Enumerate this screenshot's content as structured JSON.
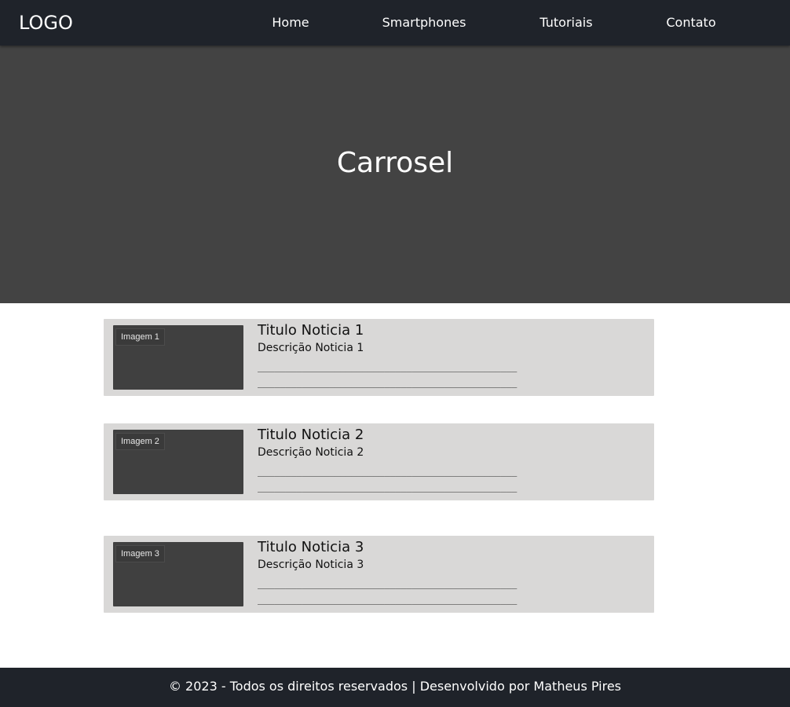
{
  "header": {
    "logo": "LOGO",
    "nav": [
      {
        "label": "Home"
      },
      {
        "label": "Smartphones"
      },
      {
        "label": "Tutoriais"
      },
      {
        "label": "Contato"
      }
    ]
  },
  "carousel": {
    "title": "Carrosel"
  },
  "news": [
    {
      "image_label": "Imagem 1",
      "title": "Titulo Noticia 1",
      "description": "Descrição Noticia 1",
      "line_1": "_______________________________________________",
      "line_2": "_______________________________________________"
    },
    {
      "image_label": "Imagem 2",
      "title": "Titulo Noticia 2",
      "description": "Descrição Noticia 2",
      "line_1": "_______________________________________________",
      "line_2": "_______________________________________________"
    },
    {
      "image_label": "Imagem 3",
      "title": "Titulo Noticia 3",
      "description": "Descrição Noticia 3",
      "line_1": "_______________________________________________",
      "line_2": "_______________________________________________"
    }
  ],
  "footer": {
    "text": "© 2023 - Todos os direitos reservados | Desenvolvido por Matheus Pires"
  }
}
